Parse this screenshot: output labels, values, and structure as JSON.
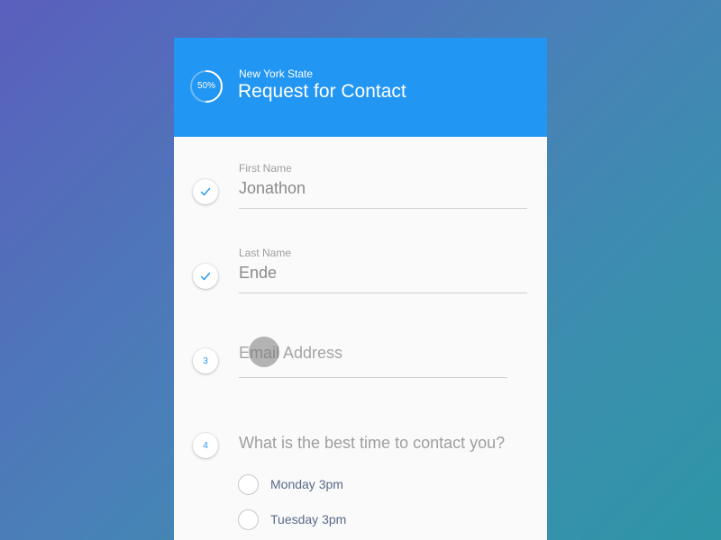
{
  "header": {
    "progress": {
      "value": 0.5,
      "label": "50%"
    },
    "subtitle": "New York State",
    "title": "Request for Contact"
  },
  "fields": {
    "first_name": {
      "label": "First Name",
      "value": "Jonathon",
      "step_icon": "check-icon"
    },
    "last_name": {
      "label": "Last Name",
      "value": "Ende",
      "step_icon": "check-icon"
    },
    "email": {
      "step": "3",
      "placeholder": "Email Address",
      "value": ""
    }
  },
  "question": {
    "step": "4",
    "text": "What is the best time to contact you?",
    "options": [
      {
        "label": "Monday 3pm",
        "selected": false
      },
      {
        "label": "Tuesday 3pm",
        "selected": false
      }
    ]
  },
  "colors": {
    "accent": "#2196f3",
    "background_start": "#5a5fbd",
    "background_end": "#2e95a6",
    "card": "#fafafa",
    "muted_text": "#9e9e9e",
    "option_text": "#5a6a88"
  }
}
